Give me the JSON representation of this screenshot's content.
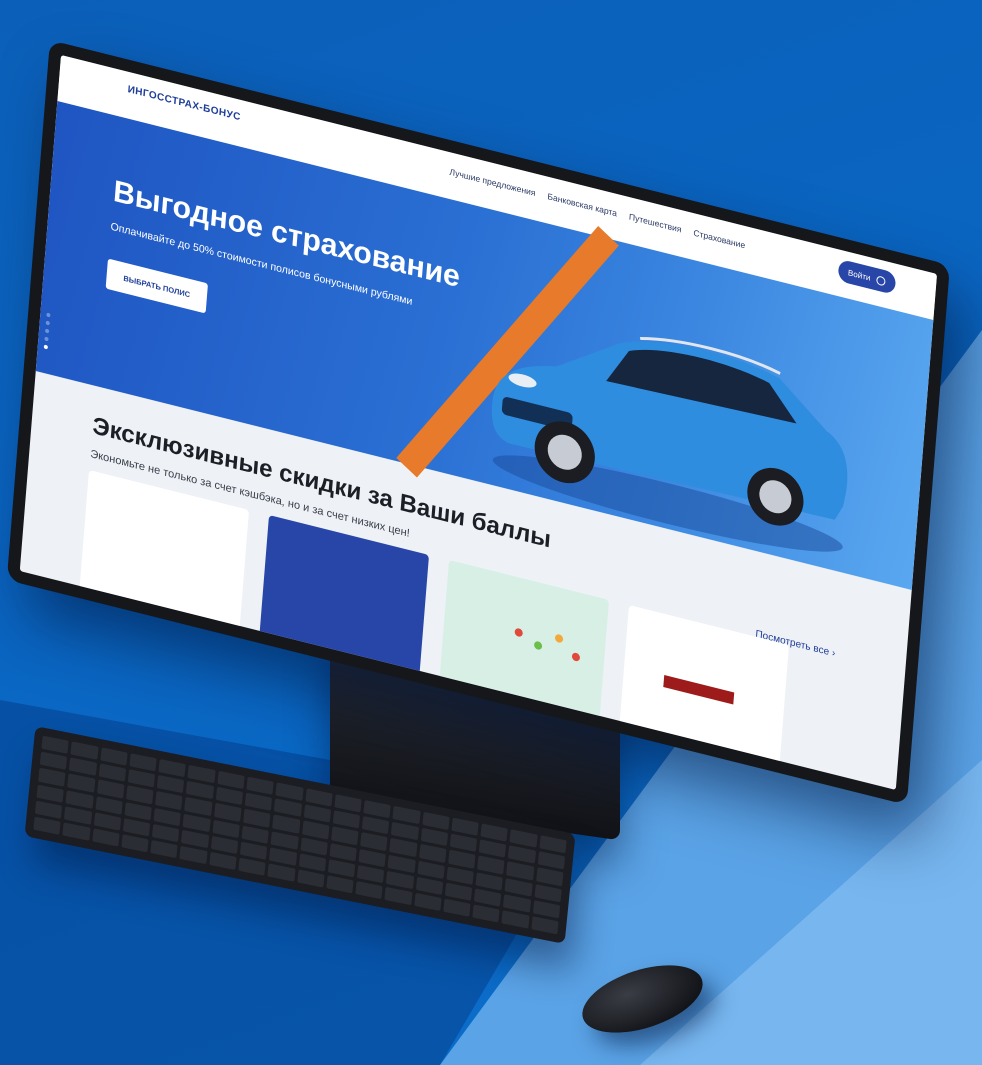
{
  "site": {
    "logo": "ИНГОССТРАХ-БОНУС",
    "menu": [
      "Лучшие предложения",
      "Банковская карта",
      "Путешествия",
      "Страхование"
    ],
    "login_label": "Войти"
  },
  "hero": {
    "title": "Выгодное страхование",
    "subtitle": "Оплачивайте до 50% стоимости полисов бонусными рублями",
    "button_label": "ВЫБРАТЬ ПОЛИС",
    "slides_total": 5,
    "active_slide": 5
  },
  "section": {
    "title": "Эксклюзивные скидки за Ваши баллы",
    "subtitle": "Экономьте не только за счет кэшбэка, но и за счет низких цен!",
    "see_all_label": "Посмотреть все",
    "see_all_icon": "chevron-right-icon"
  },
  "colors": {
    "brand_blue": "#2846a8",
    "hero_blue": "#2a6fd3",
    "accent_orange": "#e77a2b",
    "car_blue": "#2f8de0"
  }
}
